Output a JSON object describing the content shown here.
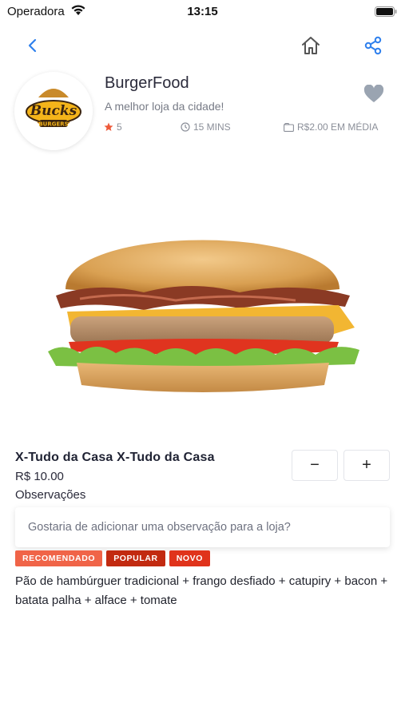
{
  "status_bar": {
    "carrier": "Operadora",
    "time": "13:15"
  },
  "nav": {
    "back_icon": "chevron-left-icon",
    "home_icon": "home-icon",
    "share_icon": "share-icon",
    "accent_color": "#2f80ed"
  },
  "store": {
    "name": "BurgerFood",
    "tagline": "A melhor loja da cidade!",
    "rating": "5",
    "delivery_time": "15 MINS",
    "average_price": "R$2.00 EM MÉDIA",
    "logo_text_top": "Bucks",
    "logo_text_bottom": "BURGERS",
    "favorite_icon": "heart-icon"
  },
  "product": {
    "title": "X-Tudo da Casa X-Tudo da Casa",
    "price": "R$ 10.00",
    "observations_label": "Observações",
    "observations_placeholder": "Gostaria de adicionar uma observação para a loja?",
    "qty_minus_label": "−",
    "qty_plus_label": "+",
    "tags": [
      {
        "label": "RECOMENDADO",
        "color": "#f06448"
      },
      {
        "label": "POPULAR",
        "color": "#c22a10"
      },
      {
        "label": "NOVO",
        "color": "#e0331b"
      }
    ],
    "description": "Pão de hambúrguer tradicional + frango desfiado + catupiry + bacon + batata palha + alface + tomate"
  }
}
